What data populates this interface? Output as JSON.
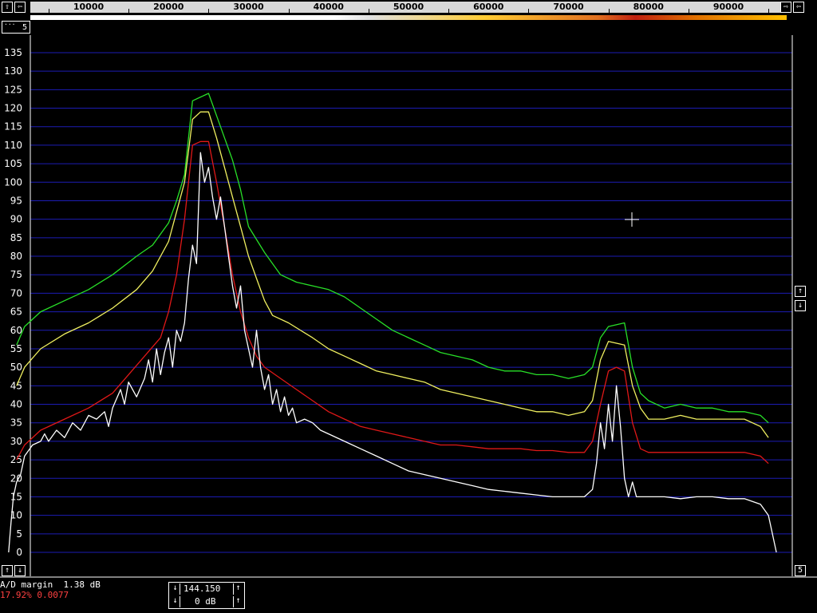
{
  "top_bar": {
    "left_arrow_outer": "⇧",
    "left_arrow_inner": "⇦",
    "right_arrow_inner": "⇨",
    "right_arrow_outer": "⇦",
    "freq_labels": [
      "10000",
      "20000",
      "30000",
      "40000",
      "50000",
      "60000",
      "70000",
      "80000",
      "90000"
    ]
  },
  "channel_box": {
    "label": "5",
    "dots": "..."
  },
  "right_scroll": {
    "up": "↑",
    "down": "↓"
  },
  "bottom_left": {
    "up": "↑",
    "down": "↓"
  },
  "bottom_right": {
    "label": "5"
  },
  "status": {
    "ad_margin": "A/D margin  1.38 dB",
    "cpu_line": "17.92% 0.0077"
  },
  "gain_box": {
    "freq_value": "144.150",
    "gain_value": "0 dB",
    "up": "↑",
    "down": "↓"
  },
  "colors": {
    "grid": "#1c1cb4",
    "green": "#28e028",
    "yellow": "#f0f060",
    "red": "#e01818",
    "white": "#ffffff"
  },
  "chart_data": {
    "type": "line",
    "x_range": [
      0,
      96500
    ],
    "ylim": [
      0,
      137
    ],
    "yticks": [
      0,
      5,
      10,
      15,
      20,
      25,
      30,
      35,
      40,
      45,
      50,
      55,
      60,
      65,
      70,
      75,
      80,
      85,
      90,
      95,
      100,
      105,
      110,
      115,
      120,
      125,
      130,
      135
    ],
    "series": [
      {
        "color": "green",
        "points": [
          [
            1000,
            56
          ],
          [
            2000,
            61
          ],
          [
            4000,
            65
          ],
          [
            7000,
            68
          ],
          [
            10000,
            71
          ],
          [
            13000,
            75
          ],
          [
            16000,
            80
          ],
          [
            18000,
            83
          ],
          [
            20000,
            89
          ],
          [
            21000,
            95
          ],
          [
            22000,
            102
          ],
          [
            23000,
            122
          ],
          [
            24000,
            123
          ],
          [
            25000,
            124
          ],
          [
            26000,
            118
          ],
          [
            27000,
            112
          ],
          [
            28000,
            106
          ],
          [
            29000,
            98
          ],
          [
            30000,
            88
          ],
          [
            32000,
            81
          ],
          [
            34000,
            75
          ],
          [
            36000,
            73
          ],
          [
            38000,
            72
          ],
          [
            40000,
            71
          ],
          [
            42000,
            69
          ],
          [
            44000,
            66
          ],
          [
            46000,
            63
          ],
          [
            48000,
            60
          ],
          [
            50000,
            58
          ],
          [
            52000,
            56
          ],
          [
            54000,
            54
          ],
          [
            56000,
            53
          ],
          [
            58000,
            52
          ],
          [
            60000,
            50
          ],
          [
            62000,
            49
          ],
          [
            64000,
            49
          ],
          [
            66000,
            48
          ],
          [
            68000,
            48
          ],
          [
            70000,
            47
          ],
          [
            72000,
            48
          ],
          [
            73000,
            50
          ],
          [
            74000,
            58
          ],
          [
            75000,
            61
          ],
          [
            77000,
            62
          ],
          [
            78000,
            50
          ],
          [
            79000,
            43
          ],
          [
            80000,
            41
          ],
          [
            82000,
            39
          ],
          [
            84000,
            40
          ],
          [
            86000,
            39
          ],
          [
            88000,
            39
          ],
          [
            90000,
            38
          ],
          [
            92000,
            38
          ],
          [
            94000,
            37
          ],
          [
            95000,
            35
          ]
        ]
      },
      {
        "color": "yellow",
        "points": [
          [
            1000,
            45
          ],
          [
            2000,
            50
          ],
          [
            4000,
            55
          ],
          [
            7000,
            59
          ],
          [
            10000,
            62
          ],
          [
            13000,
            66
          ],
          [
            16000,
            71
          ],
          [
            18000,
            76
          ],
          [
            20000,
            84
          ],
          [
            21000,
            92
          ],
          [
            22000,
            100
          ],
          [
            23000,
            117
          ],
          [
            24000,
            119
          ],
          [
            25000,
            119
          ],
          [
            26000,
            112
          ],
          [
            27000,
            104
          ],
          [
            28000,
            96
          ],
          [
            29000,
            88
          ],
          [
            30000,
            80
          ],
          [
            31000,
            74
          ],
          [
            32000,
            68
          ],
          [
            33000,
            64
          ],
          [
            35000,
            62
          ],
          [
            38000,
            58
          ],
          [
            40000,
            55
          ],
          [
            42000,
            53
          ],
          [
            44000,
            51
          ],
          [
            46000,
            49
          ],
          [
            48000,
            48
          ],
          [
            50000,
            47
          ],
          [
            52000,
            46
          ],
          [
            54000,
            44
          ],
          [
            56000,
            43
          ],
          [
            58000,
            42
          ],
          [
            60000,
            41
          ],
          [
            62000,
            40
          ],
          [
            64000,
            39
          ],
          [
            66000,
            38
          ],
          [
            68000,
            38
          ],
          [
            70000,
            37
          ],
          [
            72000,
            38
          ],
          [
            73000,
            41
          ],
          [
            74000,
            52
          ],
          [
            75000,
            57
          ],
          [
            77000,
            56
          ],
          [
            78000,
            45
          ],
          [
            79000,
            39
          ],
          [
            80000,
            36
          ],
          [
            82000,
            36
          ],
          [
            84000,
            37
          ],
          [
            86000,
            36
          ],
          [
            88000,
            36
          ],
          [
            90000,
            36
          ],
          [
            92000,
            36
          ],
          [
            94000,
            34
          ],
          [
            95000,
            31
          ]
        ]
      },
      {
        "color": "red",
        "points": [
          [
            1000,
            25
          ],
          [
            2000,
            29
          ],
          [
            4000,
            33
          ],
          [
            7000,
            36
          ],
          [
            10000,
            39
          ],
          [
            13000,
            43
          ],
          [
            15000,
            48
          ],
          [
            17000,
            53
          ],
          [
            19000,
            58
          ],
          [
            20000,
            65
          ],
          [
            21000,
            75
          ],
          [
            22000,
            90
          ],
          [
            23000,
            110
          ],
          [
            24000,
            111
          ],
          [
            25000,
            111
          ],
          [
            26000,
            100
          ],
          [
            27000,
            88
          ],
          [
            28000,
            75
          ],
          [
            29000,
            65
          ],
          [
            30000,
            58
          ],
          [
            31000,
            53
          ],
          [
            32000,
            50
          ],
          [
            34000,
            47
          ],
          [
            36000,
            44
          ],
          [
            38000,
            41
          ],
          [
            40000,
            38
          ],
          [
            42000,
            36
          ],
          [
            44000,
            34
          ],
          [
            46000,
            33
          ],
          [
            48000,
            32
          ],
          [
            50000,
            31
          ],
          [
            52000,
            30
          ],
          [
            54000,
            29
          ],
          [
            56000,
            29
          ],
          [
            58000,
            28.5
          ],
          [
            60000,
            28
          ],
          [
            62000,
            28
          ],
          [
            64000,
            28
          ],
          [
            66000,
            27.5
          ],
          [
            68000,
            27.5
          ],
          [
            70000,
            27
          ],
          [
            72000,
            27
          ],
          [
            73000,
            30
          ],
          [
            74000,
            40
          ],
          [
            75000,
            49
          ],
          [
            76000,
            50
          ],
          [
            77000,
            49
          ],
          [
            78000,
            35
          ],
          [
            79000,
            28
          ],
          [
            80000,
            27
          ],
          [
            82000,
            27
          ],
          [
            84000,
            27
          ],
          [
            86000,
            27
          ],
          [
            88000,
            27
          ],
          [
            90000,
            27
          ],
          [
            92000,
            27
          ],
          [
            94000,
            26
          ],
          [
            95000,
            24
          ]
        ]
      },
      {
        "color": "white",
        "points": [
          [
            0,
            0
          ],
          [
            300,
            8
          ],
          [
            600,
            15
          ],
          [
            1000,
            19
          ],
          [
            1500,
            21
          ],
          [
            2000,
            26
          ],
          [
            3000,
            29
          ],
          [
            4000,
            30
          ],
          [
            4500,
            32
          ],
          [
            5000,
            30
          ],
          [
            6000,
            33
          ],
          [
            7000,
            31
          ],
          [
            8000,
            35
          ],
          [
            9000,
            33
          ],
          [
            10000,
            37
          ],
          [
            11000,
            36
          ],
          [
            12000,
            38
          ],
          [
            12500,
            34
          ],
          [
            13000,
            39
          ],
          [
            14000,
            44
          ],
          [
            14500,
            40
          ],
          [
            15000,
            46
          ],
          [
            16000,
            42
          ],
          [
            17000,
            47
          ],
          [
            17500,
            52
          ],
          [
            18000,
            46
          ],
          [
            18500,
            55
          ],
          [
            19000,
            48
          ],
          [
            19500,
            54
          ],
          [
            20000,
            58
          ],
          [
            20500,
            50
          ],
          [
            21000,
            60
          ],
          [
            21500,
            57
          ],
          [
            22000,
            62
          ],
          [
            22500,
            74
          ],
          [
            23000,
            83
          ],
          [
            23500,
            78
          ],
          [
            24000,
            108
          ],
          [
            24500,
            100
          ],
          [
            25000,
            104
          ],
          [
            25500,
            96
          ],
          [
            26000,
            90
          ],
          [
            26500,
            96
          ],
          [
            27000,
            88
          ],
          [
            27500,
            80
          ],
          [
            28000,
            72
          ],
          [
            28500,
            66
          ],
          [
            29000,
            72
          ],
          [
            29500,
            60
          ],
          [
            30000,
            55
          ],
          [
            30500,
            50
          ],
          [
            31000,
            60
          ],
          [
            31500,
            50
          ],
          [
            32000,
            44
          ],
          [
            32500,
            48
          ],
          [
            33000,
            40
          ],
          [
            33500,
            44
          ],
          [
            34000,
            38
          ],
          [
            34500,
            42
          ],
          [
            35000,
            37
          ],
          [
            35500,
            39
          ],
          [
            36000,
            35
          ],
          [
            37000,
            36
          ],
          [
            38000,
            35
          ],
          [
            39000,
            33
          ],
          [
            40000,
            32
          ],
          [
            42000,
            30
          ],
          [
            44000,
            28
          ],
          [
            46000,
            26
          ],
          [
            48000,
            24
          ],
          [
            50000,
            22
          ],
          [
            52000,
            21
          ],
          [
            54000,
            20
          ],
          [
            56000,
            19
          ],
          [
            58000,
            18
          ],
          [
            60000,
            17
          ],
          [
            62000,
            16.5
          ],
          [
            64000,
            16
          ],
          [
            66000,
            15.5
          ],
          [
            68000,
            15
          ],
          [
            70000,
            15
          ],
          [
            72000,
            15
          ],
          [
            73000,
            17
          ],
          [
            73500,
            24
          ],
          [
            74000,
            35
          ],
          [
            74500,
            28
          ],
          [
            75000,
            40
          ],
          [
            75500,
            30
          ],
          [
            76000,
            45
          ],
          [
            76500,
            34
          ],
          [
            77000,
            20
          ],
          [
            77500,
            15
          ],
          [
            78000,
            19
          ],
          [
            78500,
            15
          ],
          [
            80000,
            15
          ],
          [
            82000,
            15
          ],
          [
            84000,
            14.5
          ],
          [
            86000,
            15
          ],
          [
            88000,
            15
          ],
          [
            90000,
            14.5
          ],
          [
            92000,
            14.5
          ],
          [
            94000,
            13
          ],
          [
            95000,
            10
          ],
          [
            95500,
            5
          ],
          [
            96000,
            0
          ]
        ]
      }
    ]
  }
}
